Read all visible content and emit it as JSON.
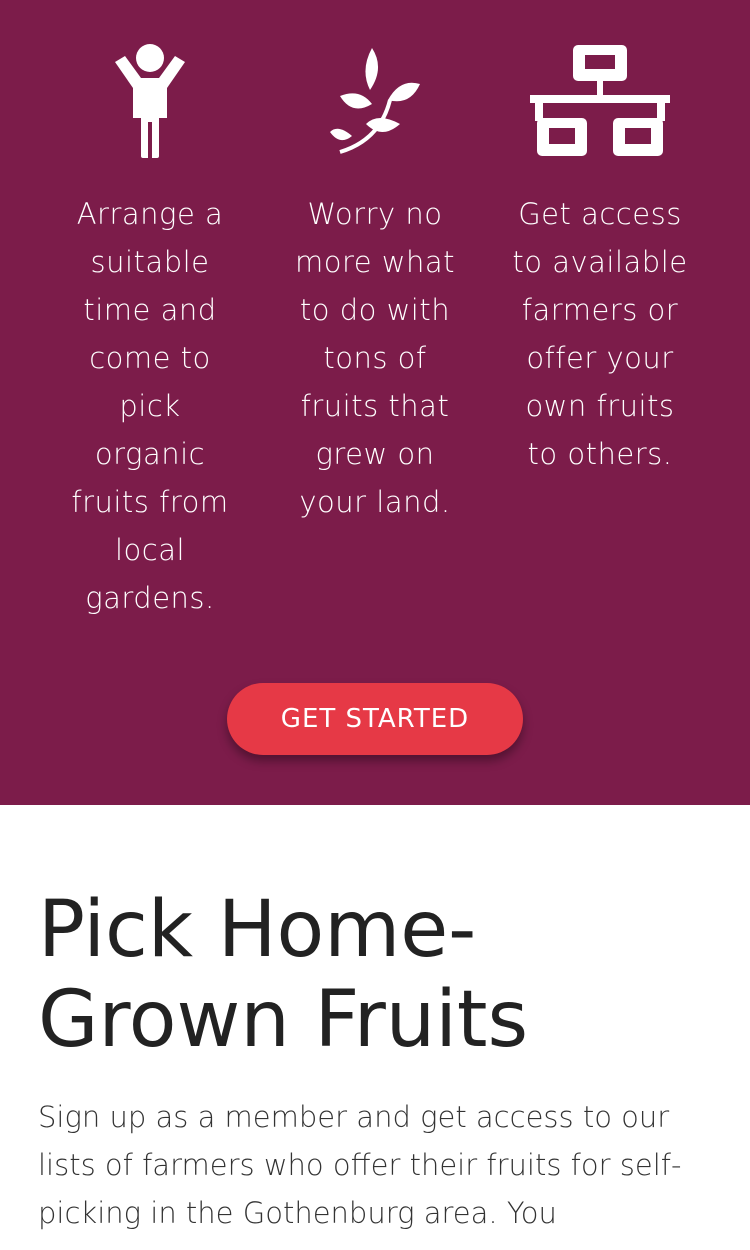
{
  "features": [
    {
      "icon": "child-icon",
      "text": "Arrange a suitable time and come to pick organic fruits from local gardens."
    },
    {
      "icon": "pagelines-leaf-icon",
      "text": "Worry no more what to do with tons of fruits that grew on your land."
    },
    {
      "icon": "sitemap-icon",
      "text": "Get access to available farmers or offer your own fruits to others."
    }
  ],
  "cta": {
    "label": "GET STARTED"
  },
  "about": {
    "title": "Pick Home-Grown Fruits",
    "body": "Sign up as a member and get access to our lists of farmers who offer their fruits for self-picking in the Gothenburg area. You"
  },
  "colors": {
    "hero_background": "#7c1c4a",
    "cta_background": "#e63946",
    "text_light": "#ffffff",
    "text_dark": "#222222"
  }
}
